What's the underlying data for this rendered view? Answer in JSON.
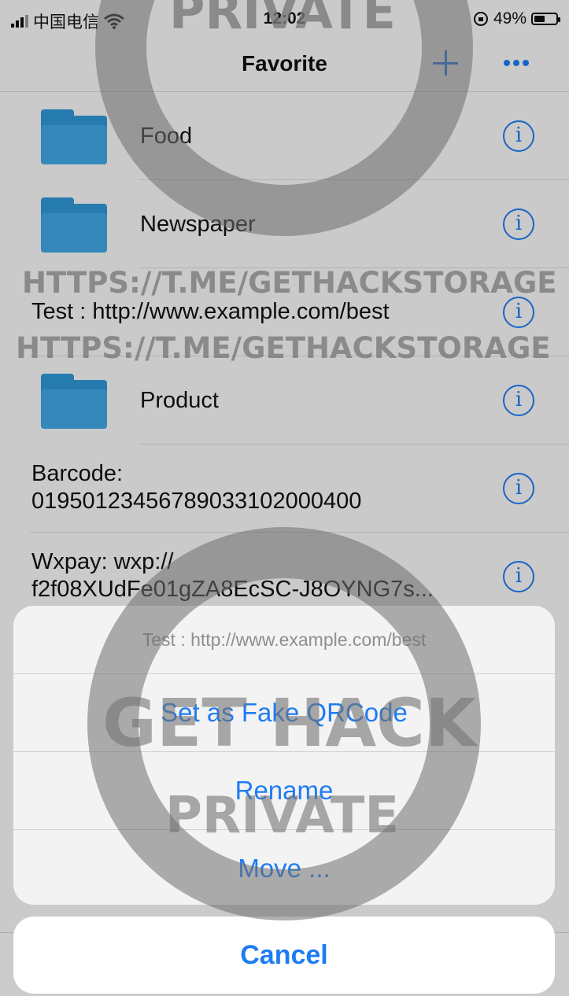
{
  "status_bar": {
    "carrier": "中国电信",
    "time": "12:02",
    "battery": "49%",
    "battery_level": 0.49
  },
  "nav": {
    "title": "Favorite"
  },
  "list": [
    {
      "kind": "folder",
      "title": "Food"
    },
    {
      "kind": "folder",
      "title": "Newspaper"
    },
    {
      "kind": "text",
      "line1": "Test : http://www.example.com/best",
      "line2": ""
    },
    {
      "kind": "folder",
      "title": "Product"
    },
    {
      "kind": "text",
      "line1": "Barcode:",
      "line2": "0195012345678903310200040 0"
    },
    {
      "kind": "text",
      "line1": "Wxpay: wxp://",
      "line2": "f2f08XUdFe01gZA8EcSC-J8OYNG7s..."
    }
  ],
  "action_sheet": {
    "title": "Test : http://www.example.com/best",
    "options": [
      "Set as Fake QRCode",
      "Rename",
      "Move ..."
    ],
    "cancel": "Cancel"
  },
  "watermark": {
    "top": "PRIVATE",
    "banner1": "HTTPS://T.ME/GETHACKSTORAGE",
    "banner2": "HTTPS://T.ME/GETHACKSTORAGE",
    "center": "GET HACK",
    "bottom": "PRIVATE"
  }
}
